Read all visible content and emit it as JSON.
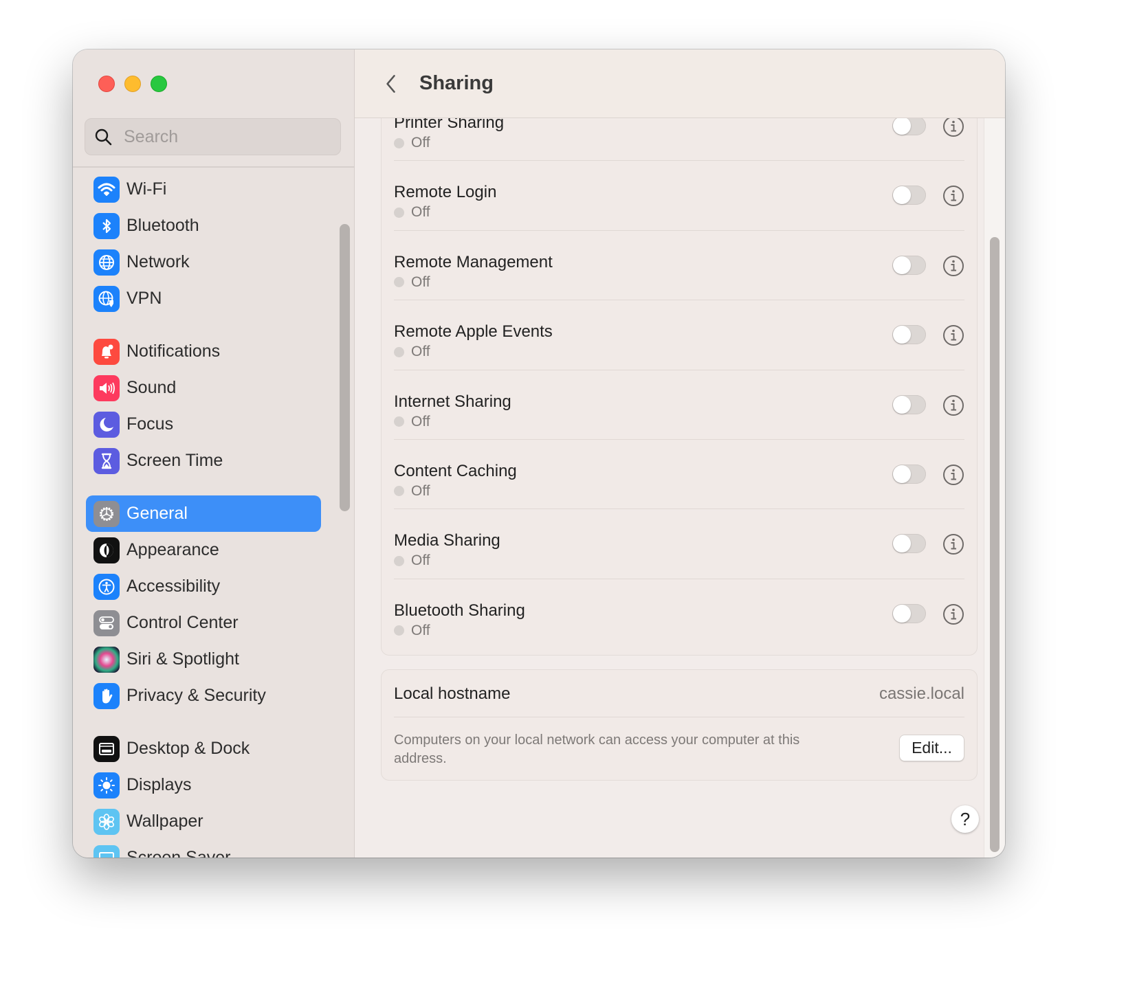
{
  "window": {
    "traffic_lights": {
      "close": "#fe5f57",
      "minimize": "#febc2e",
      "maximize": "#28c840"
    }
  },
  "sidebar": {
    "search": {
      "placeholder": "Search",
      "value": ""
    },
    "selected": "General",
    "accent_color": "#3d8ff8",
    "items": [
      {
        "label": "Wi-Fi",
        "icon": "wifi-icon",
        "color": "#1c82fb"
      },
      {
        "label": "Bluetooth",
        "icon": "bluetooth-icon",
        "color": "#1c82fb"
      },
      {
        "label": "Network",
        "icon": "globe-icon",
        "color": "#1c82fb"
      },
      {
        "label": "VPN",
        "icon": "vpn-globe-shield-icon",
        "color": "#1c82fb"
      },
      {
        "label": "Notifications",
        "icon": "bell-icon",
        "color": "#fd4a3f"
      },
      {
        "label": "Sound",
        "icon": "speaker-icon",
        "color": "#fd3a5e"
      },
      {
        "label": "Focus",
        "icon": "moon-icon",
        "color": "#5c5ce0"
      },
      {
        "label": "Screen Time",
        "icon": "hourglass-icon",
        "color": "#5c5ce0"
      },
      {
        "label": "General",
        "icon": "gear-icon",
        "color": "#8e8e93"
      },
      {
        "label": "Appearance",
        "icon": "appearance-icon",
        "color": "#111111"
      },
      {
        "label": "Accessibility",
        "icon": "accessibility-icon",
        "color": "#1c82fb"
      },
      {
        "label": "Control Center",
        "icon": "control-center-icon",
        "color": "#8e8e93"
      },
      {
        "label": "Siri & Spotlight",
        "icon": "siri-icon",
        "color": "#3a2448"
      },
      {
        "label": "Privacy & Security",
        "icon": "hand-icon",
        "color": "#1c82fb"
      },
      {
        "label": "Desktop & Dock",
        "icon": "dock-icon",
        "color": "#111111"
      },
      {
        "label": "Displays",
        "icon": "sun-icon",
        "color": "#1c82fb"
      },
      {
        "label": "Wallpaper",
        "icon": "flower-icon",
        "color": "#5ec4f2"
      },
      {
        "label": "Screen Saver",
        "icon": "screen-saver-icon",
        "color": "#5ec4f2"
      }
    ]
  },
  "main": {
    "title": "Sharing",
    "services": [
      {
        "name": "Printer Sharing",
        "status": "Off",
        "enabled": false
      },
      {
        "name": "Remote Login",
        "status": "Off",
        "enabled": false
      },
      {
        "name": "Remote Management",
        "status": "Off",
        "enabled": false
      },
      {
        "name": "Remote Apple Events",
        "status": "Off",
        "enabled": false
      },
      {
        "name": "Internet Sharing",
        "status": "Off",
        "enabled": false
      },
      {
        "name": "Content Caching",
        "status": "Off",
        "enabled": false
      },
      {
        "name": "Media Sharing",
        "status": "Off",
        "enabled": false
      },
      {
        "name": "Bluetooth Sharing",
        "status": "Off",
        "enabled": false
      }
    ],
    "hostname": {
      "label": "Local hostname",
      "value": "cassie.local",
      "description": "Computers on your local network can access your computer at this address.",
      "edit_label": "Edit..."
    },
    "help_label": "?"
  }
}
